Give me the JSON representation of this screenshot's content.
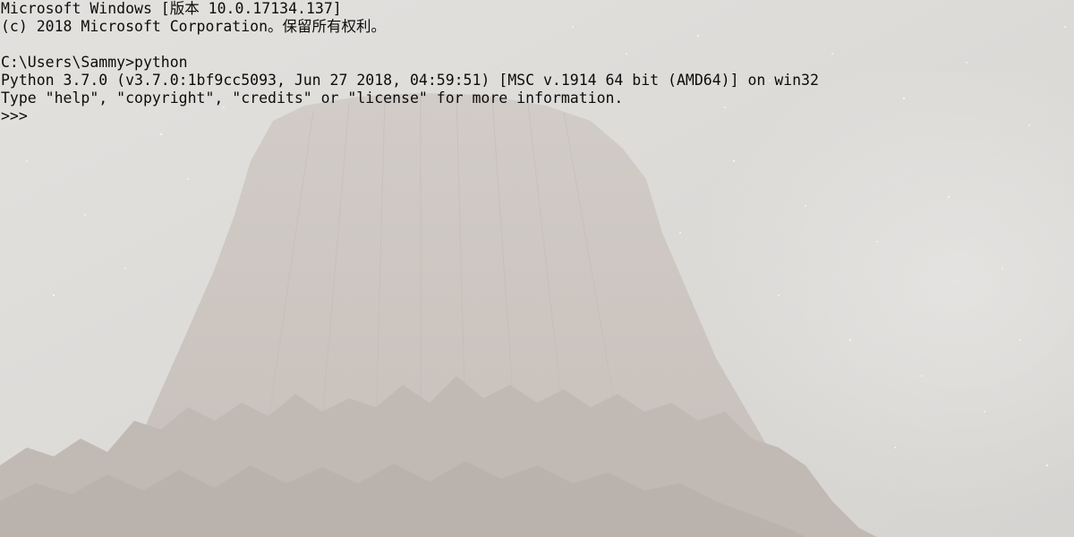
{
  "terminal": {
    "lines": [
      "Microsoft Windows [版本 10.0.17134.137]",
      "(c) 2018 Microsoft Corporation。保留所有权利。",
      "",
      "C:\\Users\\Sammy>python",
      "Python 3.7.0 (v3.7.0:1bf9cc5093, Jun 27 2018, 04:59:51) [MSC v.1914 64 bit (AMD64)] on win32",
      "Type \"help\", \"copyright\", \"credits\" or \"license\" for more information.",
      ">>>"
    ]
  },
  "background": {
    "description_colors": {
      "sky": "#dddbd8",
      "rock": "#cdc6c1",
      "trees": "#b9b3ad"
    }
  }
}
